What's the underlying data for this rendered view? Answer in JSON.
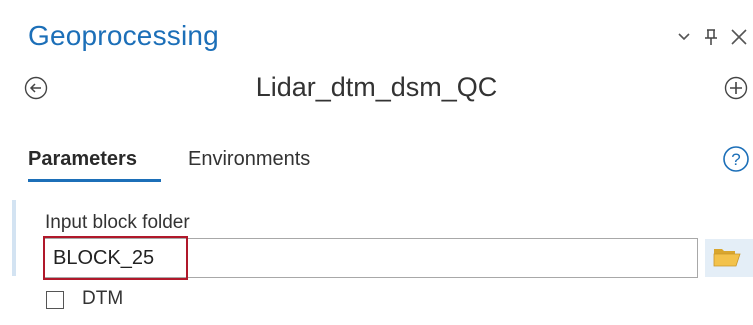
{
  "pane": {
    "title": "Geoprocessing",
    "window_controls": {
      "menu_icon": "chevron-down-icon",
      "pin_icon": "pin-icon",
      "close_icon": "close-icon"
    }
  },
  "tool": {
    "name": "Lidar_dtm_dsm_QC",
    "back_icon": "back-circle-icon",
    "add_icon": "add-circle-icon"
  },
  "tabs": {
    "parameters": "Parameters",
    "environments": "Environments",
    "active": "Parameters",
    "help_icon": "help-icon"
  },
  "parameters": {
    "input_block_folder": {
      "label": "Input block folder",
      "value": "BLOCK_25",
      "browse_icon": "folder-icon"
    },
    "dtm": {
      "label": "DTM",
      "checked": false
    }
  },
  "colors": {
    "accent_blue": "#1c6fb8",
    "highlight_red": "#b0182a",
    "folder_yellow": "#f3c24b",
    "browse_bg": "#e4eef7"
  }
}
